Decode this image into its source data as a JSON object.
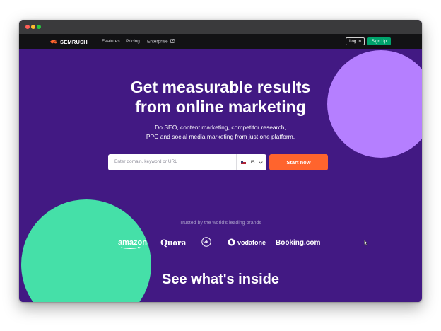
{
  "nav": {
    "brand": "SEMRUSH",
    "links": [
      "Features",
      "Pricing",
      "Enterprise"
    ],
    "login": "Log In",
    "signup": "Sign Up"
  },
  "hero": {
    "headline_line1": "Get measurable results",
    "headline_line2": "from online marketing",
    "sub_line1": "Do SEO, content marketing, competitor research,",
    "sub_line2": "PPC and social media marketing from just one platform."
  },
  "search": {
    "placeholder": "Enter domain, keyword or URL",
    "country": "US",
    "button": "Start now"
  },
  "trusted": {
    "label": "Trusted by the world's leading brands",
    "brands": [
      "amazon",
      "Quora",
      "GE",
      "vodafone",
      "Booking.com"
    ]
  },
  "section_title": "See what's inside",
  "colors": {
    "hero_bg": "#421983",
    "navbar_bg": "#121214",
    "cta_orange": "#ff642d",
    "signup_green": "#00a36c",
    "blob_purple": "#b57fff",
    "blob_green": "#45e0a8"
  },
  "icons": {
    "logo": "semrush-flame-icon",
    "external": "external-link-icon",
    "dropdown": "chevron-down-icon",
    "cursor": "mouse-pointer-icon"
  }
}
